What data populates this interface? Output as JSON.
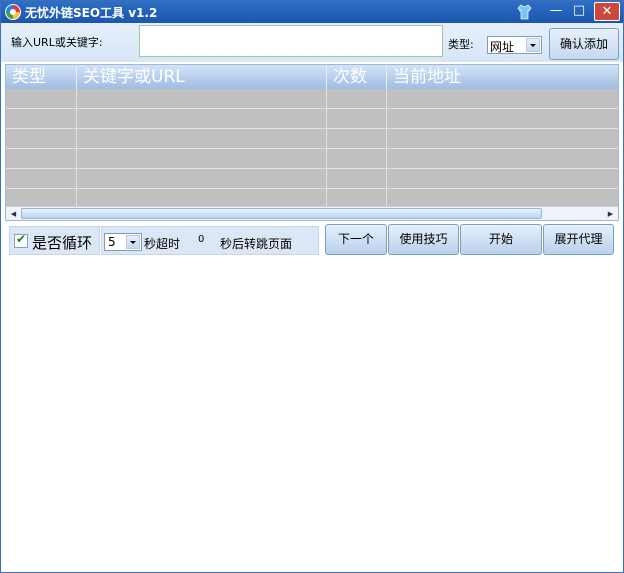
{
  "window": {
    "title": "无忧外链SEO工具 v1.2",
    "controls": {
      "minimize": "—",
      "maximize": "□",
      "close": "✕"
    }
  },
  "input_bar": {
    "url_label": "输入URL或关键字:",
    "url_value": "",
    "type_label": "类型:",
    "type_selected": "网址",
    "add_button": "确认添加"
  },
  "table": {
    "columns": [
      "类型",
      "关键字或URL",
      "次数",
      "当前地址"
    ],
    "row_count": 6
  },
  "controls": {
    "loop_label": "是否循环",
    "loop_checked": true,
    "timeout_value": "5",
    "timeout_label": "秒超时",
    "redirect_seconds": "0",
    "redirect_label": "秒后转跳页面",
    "next_button": "下一个",
    "tips_button": "使用技巧",
    "start_button": "开始",
    "proxy_button": "展开代理"
  },
  "colors": {
    "titlebar": "#1c55ae",
    "panel": "#dbe7f5",
    "grid": "#c0c0c0",
    "close_button": "#c94a3a"
  }
}
